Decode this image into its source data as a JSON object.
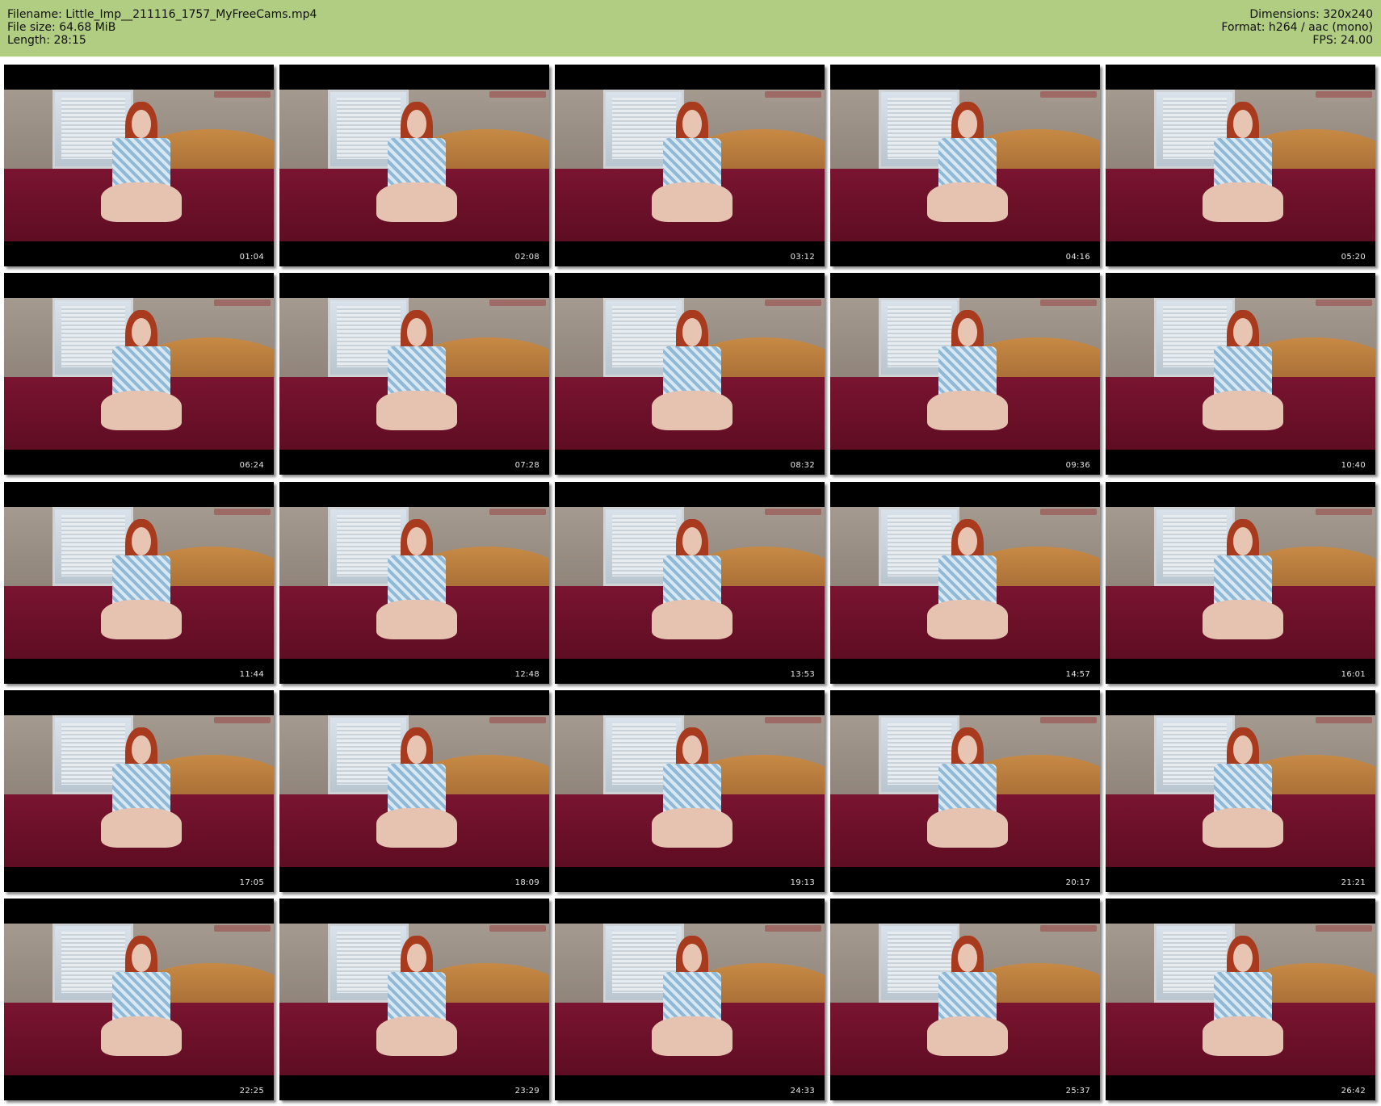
{
  "header": {
    "filename": "Filename: Little_Imp__211116_1757_MyFreeCams.mp4",
    "file_size": "File size: 64.68 MiB",
    "length": "Length: 28:15",
    "dimensions": "Dimensions: 320x240",
    "format": "Format: h264 / aac (mono)",
    "fps": "FPS: 24.00"
  },
  "colors": {
    "header_background": "#b0cd82",
    "tile_background": "#000000",
    "timestamp_text": "#e6e6e6"
  },
  "thumbnails": [
    {
      "time": "01:04"
    },
    {
      "time": "02:08"
    },
    {
      "time": "03:12"
    },
    {
      "time": "04:16"
    },
    {
      "time": "05:20"
    },
    {
      "time": "06:24"
    },
    {
      "time": "07:28"
    },
    {
      "time": "08:32"
    },
    {
      "time": "09:36"
    },
    {
      "time": "10:40"
    },
    {
      "time": "11:44"
    },
    {
      "time": "12:48"
    },
    {
      "time": "13:53"
    },
    {
      "time": "14:57"
    },
    {
      "time": "16:01"
    },
    {
      "time": "17:05"
    },
    {
      "time": "18:09"
    },
    {
      "time": "19:13"
    },
    {
      "time": "20:17"
    },
    {
      "time": "21:21"
    },
    {
      "time": "22:25"
    },
    {
      "time": "23:29"
    },
    {
      "time": "24:33"
    },
    {
      "time": "25:37"
    },
    {
      "time": "26:42"
    }
  ]
}
